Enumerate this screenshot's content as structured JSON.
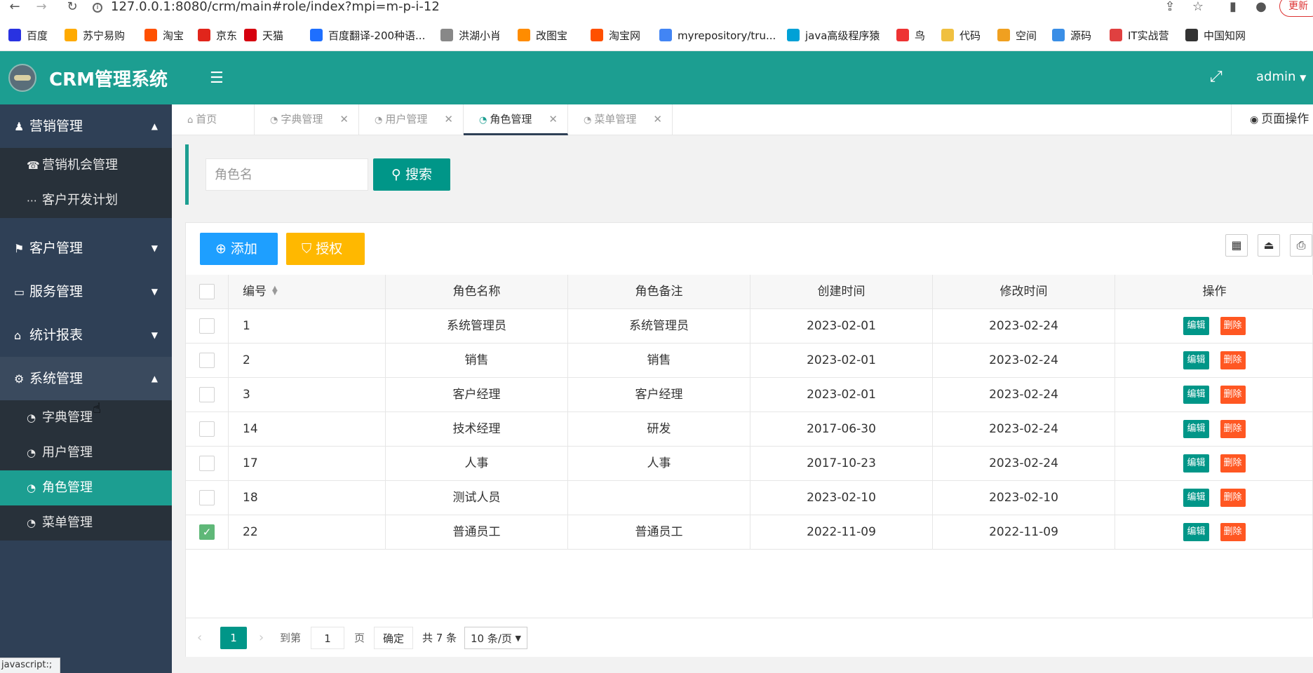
{
  "browser": {
    "url": "127.0.0.1:8080/crm/main#role/index?mpi=m-p-i-12",
    "update_label": "更新",
    "status_text": "javascript:;",
    "bookmarks": [
      {
        "label": "百度",
        "color": "#2932e1"
      },
      {
        "label": "苏宁易购",
        "color": "#ffaa00"
      },
      {
        "label": "淘宝",
        "color": "#ff5000"
      },
      {
        "label": "京东",
        "color": "#e1251b"
      },
      {
        "label": "天猫",
        "color": "#d6000f"
      },
      {
        "label": "百度翻译-200种语...",
        "color": "#1e6fff"
      },
      {
        "label": "洪湖小肖",
        "color": "#888888"
      },
      {
        "label": "改图宝",
        "color": "#ff8c00"
      },
      {
        "label": "淘宝网",
        "color": "#ff5000"
      },
      {
        "label": "myrepository/tru...",
        "color": "#4285f4"
      },
      {
        "label": "java高级程序猿",
        "color": "#00a1d6"
      },
      {
        "label": "鸟",
        "color": "#e33"
      },
      {
        "label": "代码",
        "color": "#f0c040"
      },
      {
        "label": "空间",
        "color": "#f0a020"
      },
      {
        "label": "源码",
        "color": "#3a8ee6"
      },
      {
        "label": "IT实战营",
        "color": "#e04040"
      },
      {
        "label": "中国知网",
        "color": "#333333"
      }
    ]
  },
  "app": {
    "title": "CRM管理系统",
    "user": "admin"
  },
  "sidebar": {
    "groups": [
      {
        "label": "营销管理",
        "icon": "chess-icon",
        "expanded": true,
        "items": [
          {
            "label": "营销机会管理",
            "icon": "phone-icon"
          },
          {
            "label": "客户开发计划",
            "icon": "ellipsis-icon"
          }
        ]
      },
      {
        "label": "客户管理",
        "icon": "flag-icon",
        "expanded": false
      },
      {
        "label": "服务管理",
        "icon": "desktop-icon",
        "expanded": false
      },
      {
        "label": "统计报表",
        "icon": "home-icon",
        "expanded": false
      },
      {
        "label": "系统管理",
        "icon": "gears-icon",
        "expanded": true,
        "items": [
          {
            "label": "字典管理",
            "icon": "dashboard-icon"
          },
          {
            "label": "用户管理",
            "icon": "dashboard-icon"
          },
          {
            "label": "角色管理",
            "icon": "dashboard-icon",
            "active": true
          },
          {
            "label": "菜单管理",
            "icon": "dashboard-icon"
          }
        ]
      }
    ]
  },
  "tabs": [
    {
      "label": "首页",
      "closable": false
    },
    {
      "label": "字典管理",
      "closable": true
    },
    {
      "label": "用户管理",
      "closable": true
    },
    {
      "label": "角色管理",
      "closable": true,
      "active": true
    },
    {
      "label": "菜单管理",
      "closable": true
    }
  ],
  "page_ops_label": "页面操作",
  "search": {
    "placeholder": "角色名",
    "value": "",
    "button_label": "搜索"
  },
  "toolbar": {
    "add_label": "添加",
    "auth_label": "授权"
  },
  "table": {
    "columns": [
      "编号",
      "角色名称",
      "角色备注",
      "创建时间",
      "修改时间",
      "操作"
    ],
    "edit_label": "编辑",
    "delete_label": "删除",
    "rows": [
      {
        "id": "1",
        "name": "系统管理员",
        "note": "系统管理员",
        "created": "2023-02-01",
        "modified": "2023-02-24",
        "checked": false
      },
      {
        "id": "2",
        "name": "销售",
        "note": "销售",
        "created": "2023-02-01",
        "modified": "2023-02-24",
        "checked": false
      },
      {
        "id": "3",
        "name": "客户经理",
        "note": "客户经理",
        "created": "2023-02-01",
        "modified": "2023-02-24",
        "checked": false
      },
      {
        "id": "14",
        "name": "技术经理",
        "note": "研发",
        "created": "2017-06-30",
        "modified": "2023-02-24",
        "checked": false
      },
      {
        "id": "17",
        "name": "人事",
        "note": "人事",
        "created": "2017-10-23",
        "modified": "2023-02-24",
        "checked": false
      },
      {
        "id": "18",
        "name": "测试人员",
        "note": "",
        "created": "2023-02-10",
        "modified": "2023-02-10",
        "checked": false
      },
      {
        "id": "22",
        "name": "普通员工",
        "note": "普通员工",
        "created": "2022-11-09",
        "modified": "2022-11-09",
        "checked": true
      }
    ]
  },
  "pager": {
    "current_page": "1",
    "goto_label": "到第",
    "goto_value": "1",
    "page_label": "页",
    "confirm_label": "确定",
    "total_label": "共 7 条",
    "page_size": "10 条/页"
  },
  "colors": {
    "primary": "#009688",
    "header": "#1c9e91",
    "sidebar": "#2f4056",
    "add": "#1e9fff",
    "auth": "#ffb800",
    "delete": "#ff5722"
  }
}
